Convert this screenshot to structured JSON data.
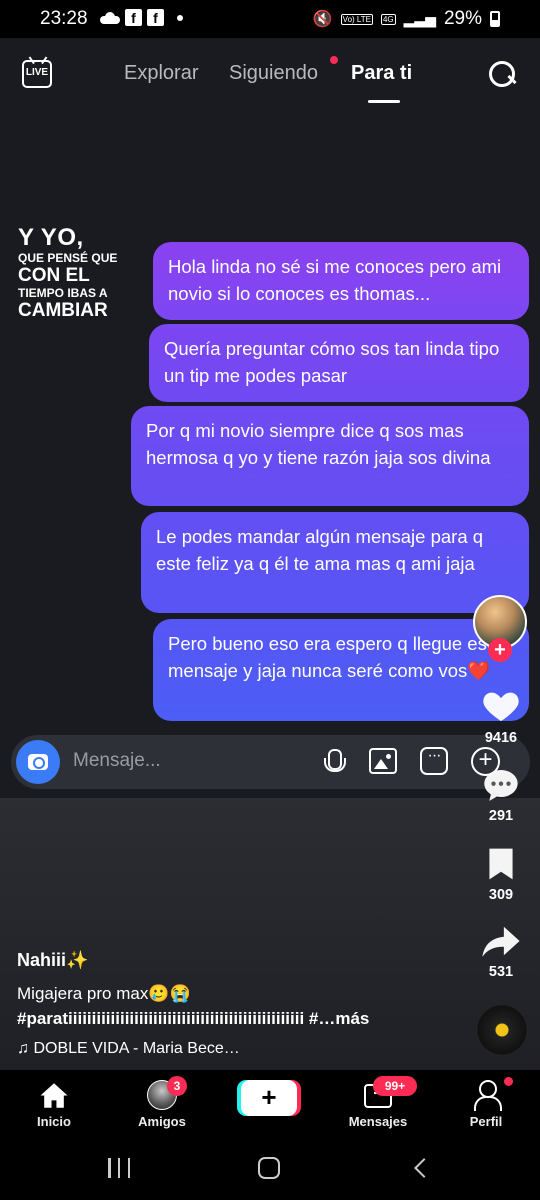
{
  "status_bar": {
    "time": "23:28",
    "network": "4G",
    "volte": "Vo) LTE",
    "battery": "29%"
  },
  "top_nav": {
    "live_label": "LIVE",
    "tabs": [
      "Explorar",
      "Siguiendo",
      "Para ti"
    ],
    "active_tab": "Para ti"
  },
  "overlay_caption": {
    "line1": "Y YO,",
    "line2": "QUE PENSÉ QUE",
    "line3": "CON EL",
    "line4": "TIEMPO IBAS A",
    "line5": "CAMBIAR"
  },
  "chat": {
    "messages": [
      "Hola linda no sé si me conoces pero ami novio si lo conoces es thomas...",
      "Quería preguntar cómo sos tan linda tipo un tip me podes pasar",
      "Por q mi novio siempre dice q sos mas hermosa q yo y tiene razón jaja sos divina",
      "Le podes mandar algún mensaje para q este feliz ya q él te ama mas q ami jaja",
      "Pero bueno eso era espero q llegue ese mensaje y jaja nunca seré como vos❤️"
    ],
    "input_placeholder": "Mensaje..."
  },
  "actions": {
    "likes": "9416",
    "comments": "291",
    "saves": "309",
    "shares": "531"
  },
  "post": {
    "username": "Nahiii✨",
    "description": "Migajera pro max🥲😭",
    "hashtags": "#paratiiiiiiiiiiiiiiiiiiiiiiiiiiiiiiiiiiiiiiiiiiiiiiiiii #…más",
    "music": "♫ DOBLE VIDA - Maria Bece…"
  },
  "bottom_nav": {
    "items": [
      {
        "label": "Inicio"
      },
      {
        "label": "Amigos",
        "badge": "3"
      },
      {
        "label": "",
        "create": "+"
      },
      {
        "label": "Mensajes",
        "badge": "99+"
      },
      {
        "label": "Perfil"
      }
    ]
  },
  "colors": {
    "accent": "#fe2c55",
    "bubble_start": "#8b42f0",
    "bubble_end": "#4b5ef5",
    "camera_button": "#3b7bf5"
  }
}
